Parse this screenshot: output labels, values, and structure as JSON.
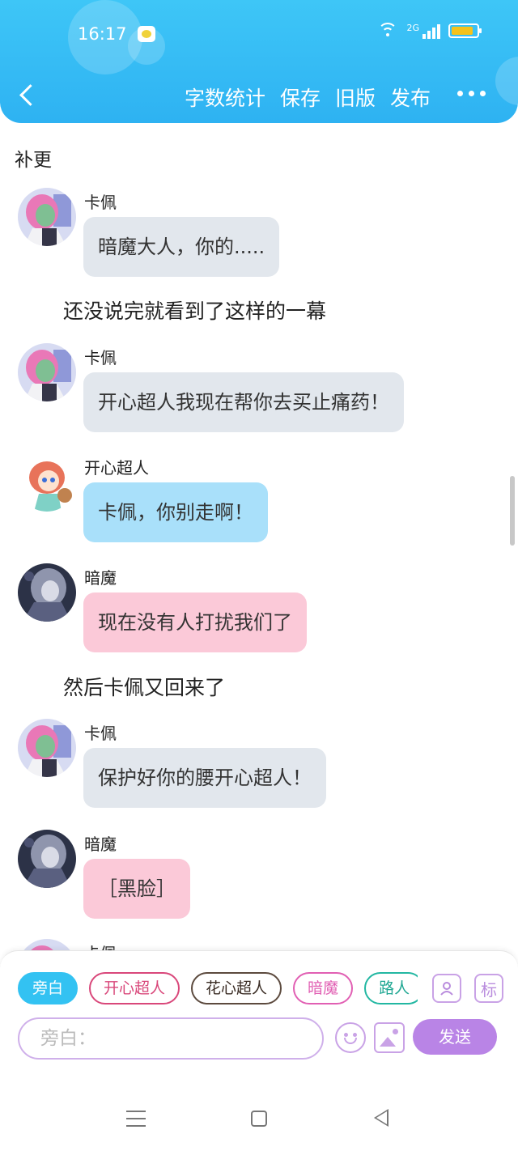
{
  "status_bar": {
    "time": "16:17",
    "network": "2G"
  },
  "nav": {
    "actions": [
      "字数统计",
      "保存",
      "旧版",
      "发布"
    ]
  },
  "chapter_title": "补更",
  "messages": [
    {
      "type": "dialog",
      "speaker": "卡佩",
      "text": "暗魔大人，你的.....",
      "bubble": "gray",
      "avatar": "kapei"
    },
    {
      "type": "narration",
      "text": "还没说完就看到了这样的一幕"
    },
    {
      "type": "dialog",
      "speaker": "卡佩",
      "text": "开心超人我现在帮你去买止痛药！",
      "bubble": "gray",
      "avatar": "kapei"
    },
    {
      "type": "dialog",
      "speaker": "开心超人",
      "text": "卡佩，你别走啊！",
      "bubble": "blue",
      "avatar": "kaixin"
    },
    {
      "type": "dialog",
      "speaker": "暗魔",
      "text": "现在没有人打扰我们了",
      "bubble": "pink",
      "avatar": "anmo"
    },
    {
      "type": "narration",
      "text": "然后卡佩又回来了"
    },
    {
      "type": "dialog",
      "speaker": "卡佩",
      "text": "保护好你的腰开心超人！",
      "bubble": "gray",
      "avatar": "kapei"
    },
    {
      "type": "dialog",
      "speaker": "暗魔",
      "text": "［黑脸］",
      "bubble": "pink",
      "avatar": "anmo"
    },
    {
      "type": "dialog",
      "speaker": "卡佩",
      "text": "",
      "bubble": "gray",
      "avatar": "kapei"
    }
  ],
  "composer": {
    "roles": [
      "旁白",
      "开心超人",
      "花心超人",
      "暗魔",
      "路人"
    ],
    "active_role": "旁白",
    "role_button_icon": "person-card-icon",
    "tag_button_label": "标",
    "input_placeholder": "旁白：",
    "send_label": "发送"
  },
  "colors": {
    "header": "#2eb2f2",
    "bubble_gray": "#e2e7ed",
    "bubble_blue": "#a9e0fa",
    "bubble_pink": "#fbc9d8",
    "accent_purple": "#b984e6"
  }
}
